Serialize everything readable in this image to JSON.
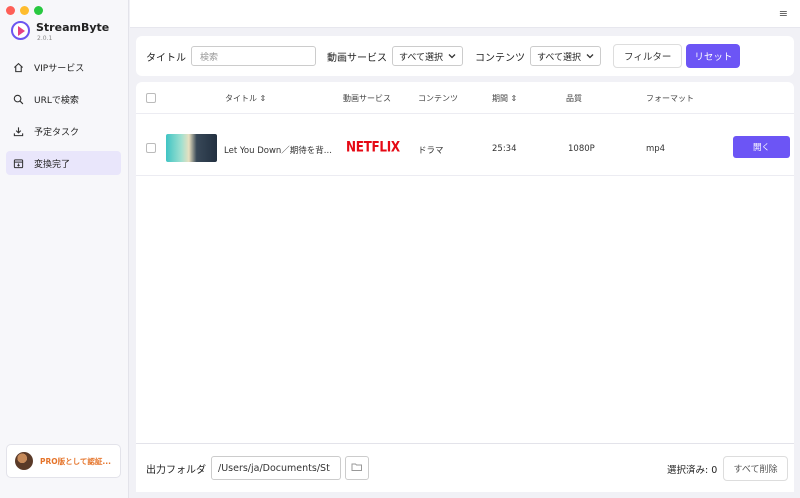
{
  "app": {
    "name": "StreamByte",
    "version": "2.0.1"
  },
  "sidebar": {
    "items": [
      {
        "label": "VIPサービス",
        "icon": "home-icon"
      },
      {
        "label": "URLで検索",
        "icon": "search-icon"
      },
      {
        "label": "予定タスク",
        "icon": "download-icon"
      },
      {
        "label": "変換完了",
        "icon": "converted-icon",
        "active": true
      }
    ],
    "pro_label": "PRO版として認証..."
  },
  "filter": {
    "title_label": "タイトル",
    "search_placeholder": "検索",
    "service_label": "動画サービス",
    "service_value": "すべて選択",
    "content_label": "コンテンツ",
    "content_value": "すべて選択",
    "filter_button": "フィルター",
    "reset_button": "リセット"
  },
  "table": {
    "headers": {
      "title": "タイトル",
      "service": "動画サービス",
      "content": "コンテンツ",
      "duration": "期間",
      "quality": "品質",
      "format": "フォーマット"
    },
    "rows": [
      {
        "title": "Let You Down／期待を背...",
        "service": "NETFLIX",
        "content": "ドラマ",
        "duration": "25:34",
        "quality": "1080P",
        "format": "mp4",
        "action": "開く"
      }
    ]
  },
  "footer": {
    "output_label": "出力フォルダ",
    "output_path": "/Users/ja/Documents/St",
    "selected_text": "選択済み: 0",
    "delete_all": "すべて削除"
  },
  "colors": {
    "accent": "#6c55f5",
    "netflix": "#e50914",
    "pro": "#e5742a"
  }
}
